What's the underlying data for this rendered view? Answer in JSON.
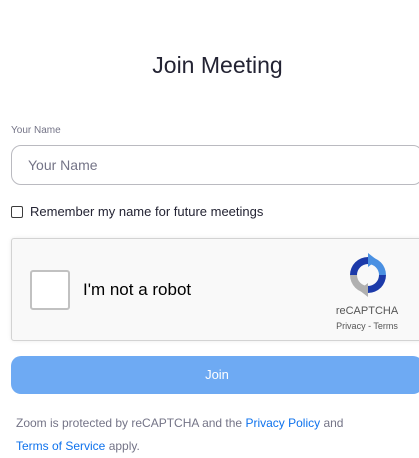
{
  "header": {
    "title": "Join Meeting"
  },
  "name_field": {
    "label": "Your Name",
    "placeholder": "Your Name"
  },
  "remember": {
    "label": "Remember my name for future meetings"
  },
  "captcha": {
    "label": "I'm not a robot",
    "brand": "reCAPTCHA",
    "privacy_link": "Privacy",
    "separator": " - ",
    "terms_link": "Terms"
  },
  "join_button": {
    "label": "Join"
  },
  "footer": {
    "text_1": "Zoom is protected by reCAPTCHA and the ",
    "privacy_link": "Privacy Policy",
    "text_2": " and",
    "terms_link": "Terms of Service",
    "text_3": " apply."
  },
  "colors": {
    "primary_button": "#6eaaf3",
    "link": "#0e72ed",
    "text": "#232333",
    "muted_text": "#747487"
  }
}
